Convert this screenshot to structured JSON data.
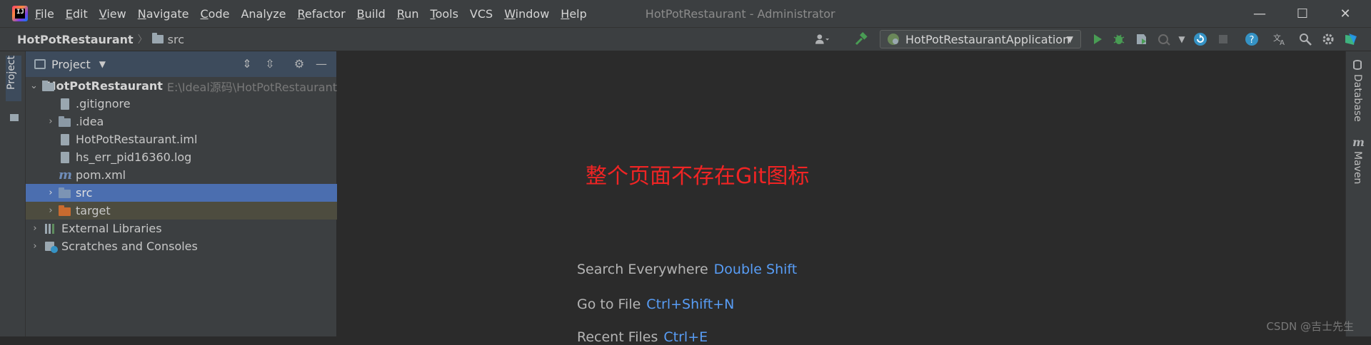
{
  "app": {
    "logo_letters": "IJ",
    "window_title": "HotPotRestaurant - Administrator"
  },
  "menu": [
    {
      "label": "File",
      "mnemonic": "F",
      "rest": "ile"
    },
    {
      "label": "Edit",
      "mnemonic": "E",
      "rest": "dit"
    },
    {
      "label": "View",
      "mnemonic": "V",
      "rest": "iew"
    },
    {
      "label": "Navigate",
      "mnemonic": "N",
      "rest": "avigate"
    },
    {
      "label": "Code",
      "mnemonic": "C",
      "rest": "ode"
    },
    {
      "label": "Analyze",
      "mnemonic": "",
      "rest": "Analyze"
    },
    {
      "label": "Refactor",
      "mnemonic": "R",
      "rest": "efactor"
    },
    {
      "label": "Build",
      "mnemonic": "B",
      "rest": "uild"
    },
    {
      "label": "Run",
      "mnemonic": "R",
      "rest": "un"
    },
    {
      "label": "Tools",
      "mnemonic": "T",
      "rest": "ools"
    },
    {
      "label": "VCS",
      "mnemonic": "",
      "rest": "VCS"
    },
    {
      "label": "Window",
      "mnemonic": "W",
      "rest": "indow"
    },
    {
      "label": "Help",
      "mnemonic": "H",
      "rest": "elp"
    }
  ],
  "window_controls": {
    "minimize": "—",
    "maximize": "☐",
    "close": "✕"
  },
  "breadcrumb": {
    "project": "HotPotRestaurant",
    "folder": "src"
  },
  "run_config": {
    "label": "HotPotRestaurantApplication"
  },
  "project_panel": {
    "title": "Project",
    "tree": [
      {
        "name": "HotPotRestaurant",
        "hint": "E:\\Ideal源码\\HotPotRestaurant",
        "depth": 0,
        "expanded": true,
        "icon": "module-icon",
        "bold": true
      },
      {
        "name": ".gitignore",
        "depth": 1,
        "icon": "file-icon"
      },
      {
        "name": ".idea",
        "depth": 1,
        "expandable": true,
        "icon": "folder-icon"
      },
      {
        "name": "HotPotRestaurant.iml",
        "depth": 1,
        "icon": "file-icon"
      },
      {
        "name": "hs_err_pid16360.log",
        "depth": 1,
        "icon": "file-icon"
      },
      {
        "name": "pom.xml",
        "depth": 1,
        "icon": "maven-icon"
      },
      {
        "name": "src",
        "depth": 1,
        "expandable": true,
        "icon": "folder-icon",
        "selected": true
      },
      {
        "name": "target",
        "depth": 1,
        "expandable": true,
        "icon": "folder-icon",
        "excluded": true
      },
      {
        "name": "External Libraries",
        "depth": 0,
        "expandable": true,
        "icon": "libraries-icon"
      },
      {
        "name": "Scratches and Consoles",
        "depth": 0,
        "expandable": true,
        "icon": "scratches-icon"
      }
    ]
  },
  "left_strip": {
    "project_tab": "Project"
  },
  "right_strip": {
    "database_tab": "Database",
    "maven_tab": "Maven"
  },
  "editor": {
    "annotation": "整个页面不存在Git图标",
    "hints": [
      {
        "action": "Search Everywhere",
        "shortcut": "Double Shift"
      },
      {
        "action": "Go to File",
        "shortcut": "Ctrl+Shift+N"
      },
      {
        "action": "Recent Files",
        "shortcut": "Ctrl+E"
      }
    ]
  },
  "watermark": "CSDN @吉士先生",
  "colors": {
    "accent": "#4b6eaf",
    "shortcut": "#589df6",
    "annotation": "#f02424",
    "run_green": "#499c54"
  }
}
